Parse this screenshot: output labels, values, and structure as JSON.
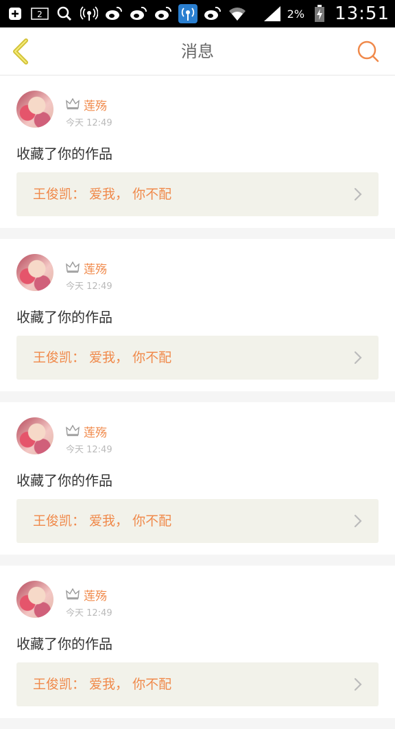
{
  "status_bar": {
    "icons": [
      "plus-box-icon",
      "notification-count-icon",
      "search-icon",
      "hotspot-icon",
      "weibo-icon",
      "weibo-icon",
      "weibo-icon",
      "hotspot-active-icon",
      "weibo-icon",
      "wifi-icon",
      "signal-icon"
    ],
    "notification_count": "2",
    "battery_percent": "2%",
    "time": "13:51"
  },
  "header": {
    "title": "消息"
  },
  "colors": {
    "accent": "#f0894a",
    "back_arrow": "#d3c238",
    "card_bg": "#ffffff",
    "work_bg": "#f2f2ea",
    "page_bg": "#f5f5f5"
  },
  "messages": [
    {
      "username": "莲殇",
      "time": "今天 12:49",
      "action": "收藏了你的作品",
      "work": "王俊凯：  爱我，  你不配"
    },
    {
      "username": "莲殇",
      "time": "今天 12:49",
      "action": "收藏了你的作品",
      "work": "王俊凯：  爱我，  你不配"
    },
    {
      "username": "莲殇",
      "time": "今天 12:49",
      "action": "收藏了你的作品",
      "work": "王俊凯：  爱我，  你不配"
    },
    {
      "username": "莲殇",
      "time": "今天 12:49",
      "action": "收藏了你的作品",
      "work": "王俊凯：  爱我，  你不配"
    }
  ]
}
